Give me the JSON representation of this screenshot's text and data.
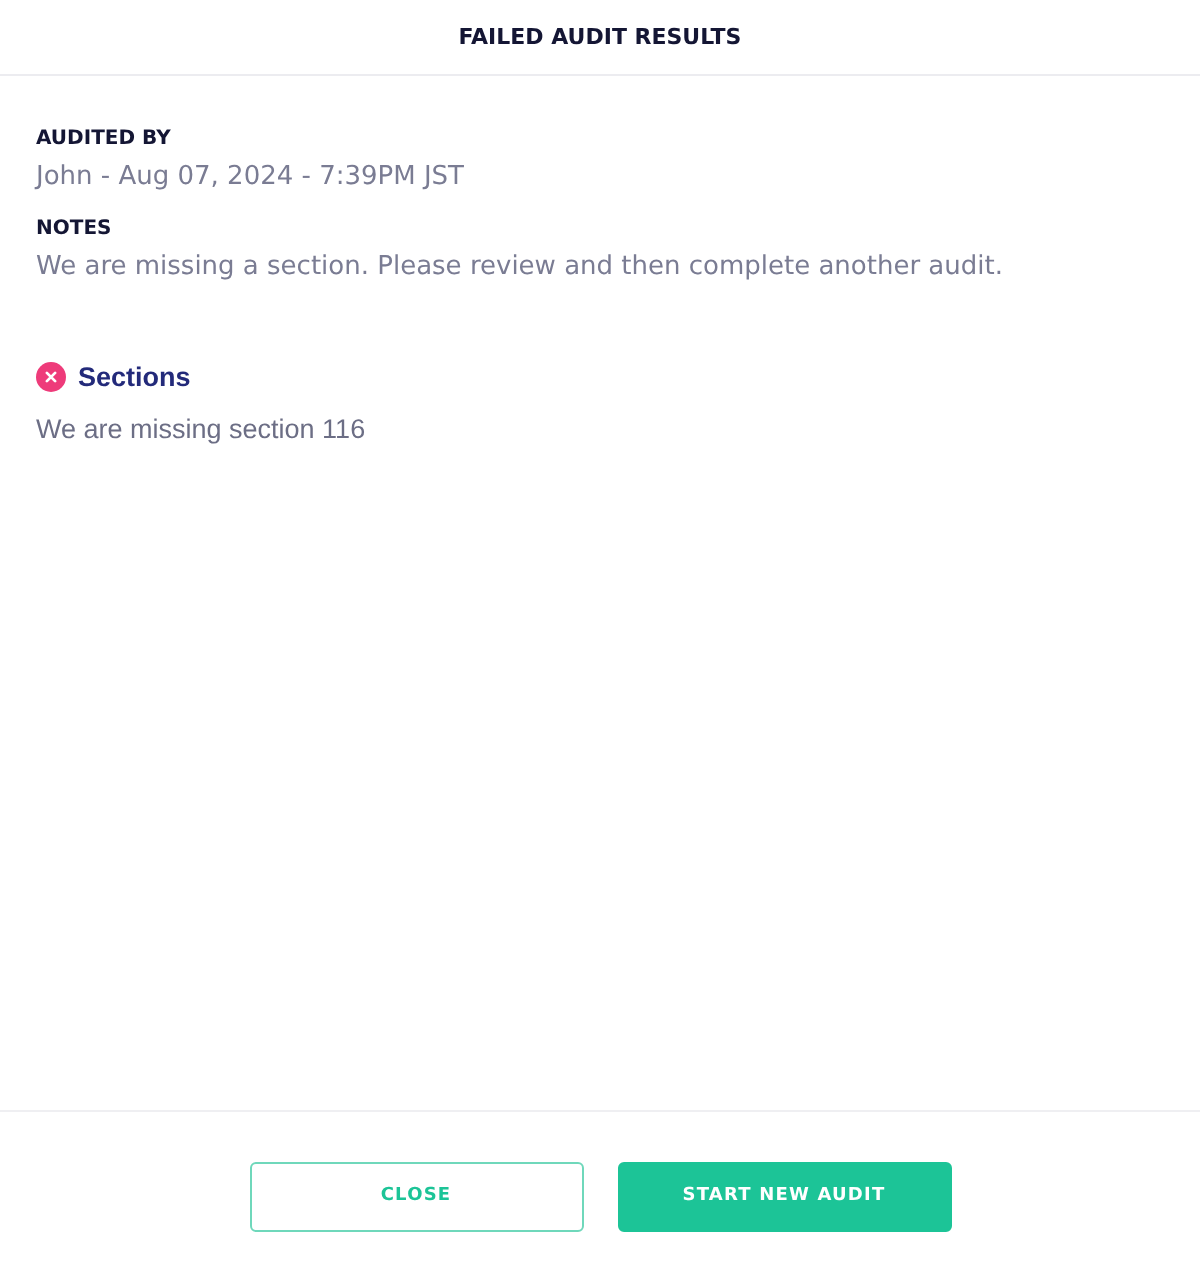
{
  "modal": {
    "title": "FAILED AUDIT RESULTS"
  },
  "fields": [
    {
      "label": "AUDITED BY",
      "value": "John - Aug 07, 2024 - 7:39PM JST"
    },
    {
      "label": "NOTES",
      "value": "We are missing a section. Please review and then complete another audit."
    }
  ],
  "checks": [
    {
      "title": "Sections",
      "failed": true,
      "message": "We are missing section 116"
    }
  ],
  "buttons": [
    {
      "label": "CLOSE",
      "kind": "outline"
    },
    {
      "label": "START NEW AUDIT",
      "kind": "primary"
    }
  ]
}
